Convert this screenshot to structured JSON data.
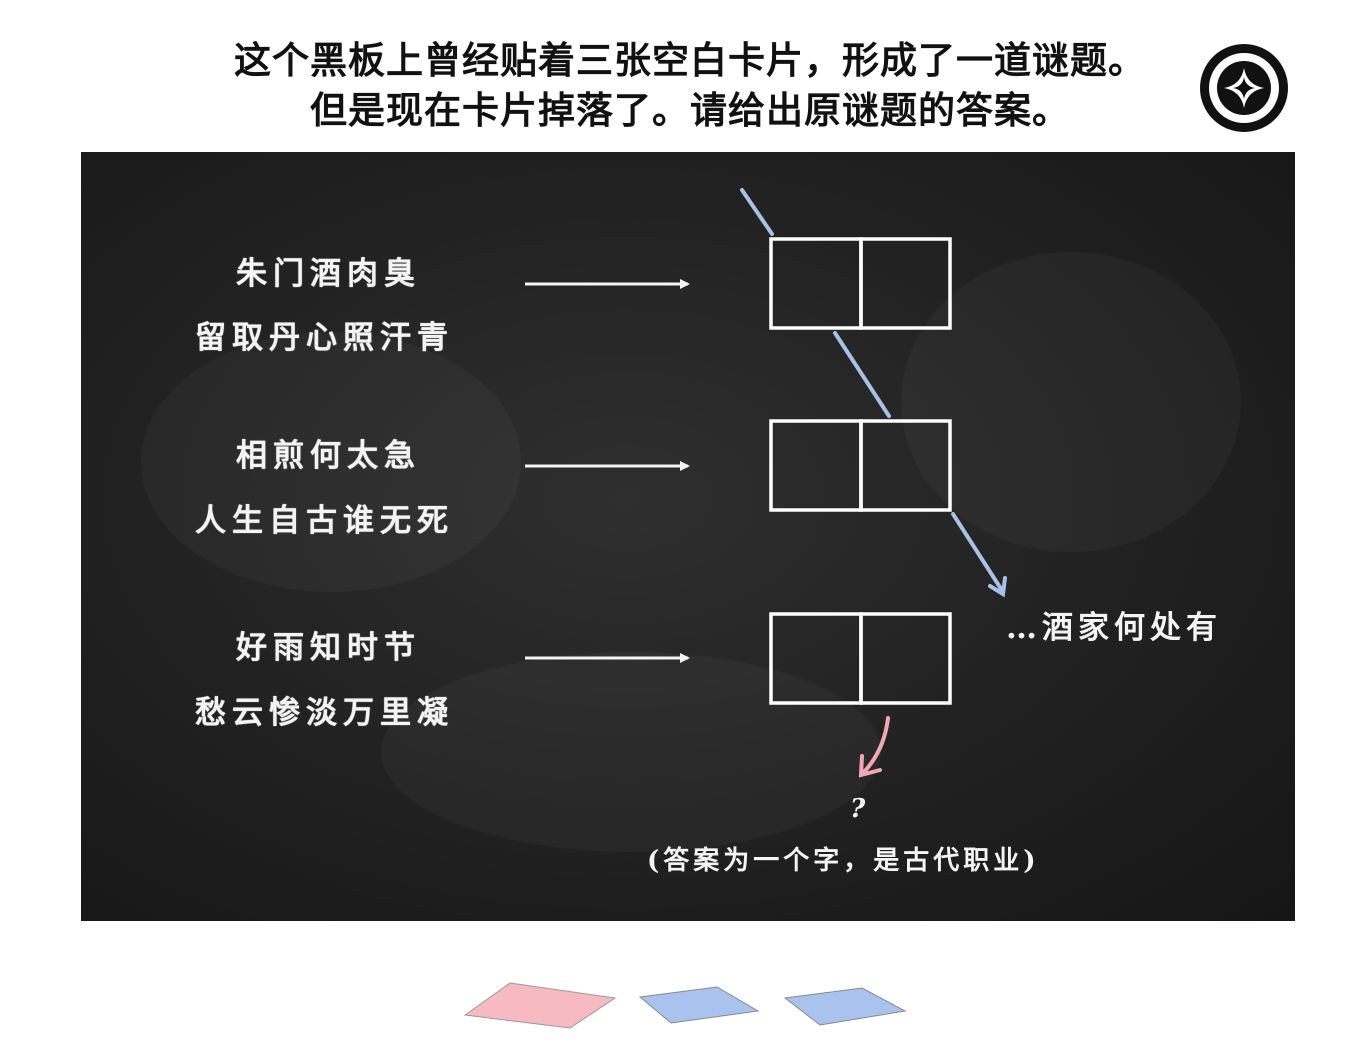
{
  "title": {
    "line1": "这个黑板上曾经贴着三张空白卡片，形成了一道谜题。",
    "line2": "但是现在卡片掉落了。请给出原谜题的答案。"
  },
  "logo_icon": "compass-star-icon",
  "puzzles": [
    {
      "line1": "朱门酒肉臭",
      "line2": "留取丹心照汗青"
    },
    {
      "line1": "相煎何太急",
      "line2": "人生自古谁无死"
    },
    {
      "line1": "好雨知时节",
      "line2": "愁云惨淡万里凝"
    }
  ],
  "hint_text": "…酒家何处有",
  "question_mark": "?",
  "answer_note": "(答案为一个字，是古代职业)",
  "colors": {
    "board": "#222222",
    "chalk": "#f4f4f4",
    "blue_arrow": "#a9c1e6",
    "pink_arrow": "#f0a8b4",
    "card_pink": "#f7b9c2",
    "card_blue": "#aac3ee"
  }
}
